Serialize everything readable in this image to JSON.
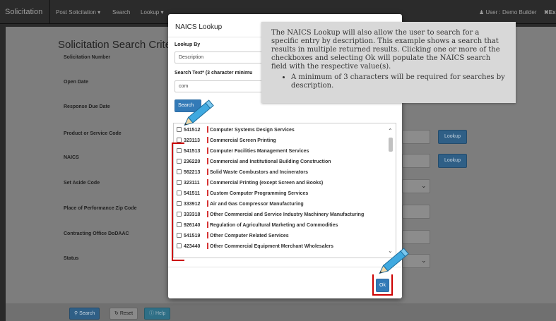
{
  "navbar": {
    "brand": "Solicitation",
    "items": [
      "Post Solicitation ▾",
      "Search",
      "Lookup ▾"
    ],
    "user": "User : Demo Builder",
    "exit": "Ex"
  },
  "page": {
    "title": "Solicitation Search Criteri",
    "fields": [
      "Solicitation Number",
      "Open Date",
      "Response Due Date",
      "Product or Service Code",
      "NAICS",
      "Set Aside Code",
      "Place of Performance Zip Code",
      "Contracting Office DoDAAC",
      "Status"
    ],
    "lookup_label": "Lookup",
    "footer": {
      "search": "Search",
      "reset": "Reset",
      "help": "Help"
    }
  },
  "modal": {
    "title": "NAICS Lookup",
    "lookup_by_label": "Lookup By",
    "lookup_by_value": "Description",
    "search_text_label": "Search Text* (3 character minimu",
    "search_text_value": "com",
    "search_button": "Search",
    "ok_button": "Ok",
    "results": [
      {
        "code": "541512",
        "desc": "Computer Systems Design Services"
      },
      {
        "code": "323113",
        "desc": "Commercial Screen Printing"
      },
      {
        "code": "541513",
        "desc": "Computer Facilities Management Services"
      },
      {
        "code": "236220",
        "desc": "Commercial and Institutional Building Construction"
      },
      {
        "code": "562213",
        "desc": "Solid Waste Combustors and Incinerators"
      },
      {
        "code": "323111",
        "desc": "Commercial Printing (except Screen and Books)"
      },
      {
        "code": "541511",
        "desc": "Custom Computer Programming Services"
      },
      {
        "code": "333912",
        "desc": "Air and Gas Compressor Manufacturing"
      },
      {
        "code": "333318",
        "desc": "Other Commercial and Service Industry Machinery Manufacturing"
      },
      {
        "code": "926140",
        "desc": "Regulation of Agricultural Marketing and Commodities"
      },
      {
        "code": "541519",
        "desc": "Other Computer Related Services"
      },
      {
        "code": "423440",
        "desc": "Other Commercial Equipment Merchant Wholesalers"
      }
    ]
  },
  "callout": {
    "text": "The NAICS Lookup will also allow the user to search for a specific entry by description.  This example shows a search that results in multiple returned results. Clicking one or more of the checkboxes and selecting Ok will populate the NAICS search field with the respective value(s).",
    "bullet": "A minimum of 3 characters will be required for searches by description."
  },
  "colors": {
    "accent": "#337ab7",
    "annotation_red": "#cc0000",
    "pencil_blue": "#3fa9e0"
  }
}
